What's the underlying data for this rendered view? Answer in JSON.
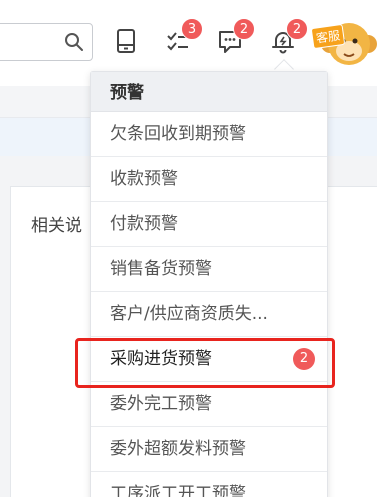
{
  "header": {
    "search": {
      "placeholder": ""
    },
    "icons": [
      {
        "name": "mobile-icon",
        "badge": ""
      },
      {
        "name": "checklist-icon",
        "badge": "3"
      },
      {
        "name": "message-icon",
        "badge": "2"
      },
      {
        "name": "bell-icon",
        "badge": "2"
      }
    ],
    "avatar_tag": "客服"
  },
  "content": {
    "card_title": "相关说"
  },
  "dropdown": {
    "title": "预警",
    "items": [
      {
        "label": "欠条回收到期预警"
      },
      {
        "label": "收款预警"
      },
      {
        "label": "付款预警"
      },
      {
        "label": "销售备货预警"
      },
      {
        "label": "客户/供应商资质失..."
      },
      {
        "label": "采购进货预警",
        "badge": "2",
        "highlighted": true
      },
      {
        "label": "委外完工预警"
      },
      {
        "label": "委外超额发料预警"
      },
      {
        "label": "工序派工开工预警"
      }
    ]
  },
  "colors": {
    "badge": "#f05a5a",
    "highlight_frame": "#e8241e",
    "page_bg": "#f3f4f6"
  }
}
